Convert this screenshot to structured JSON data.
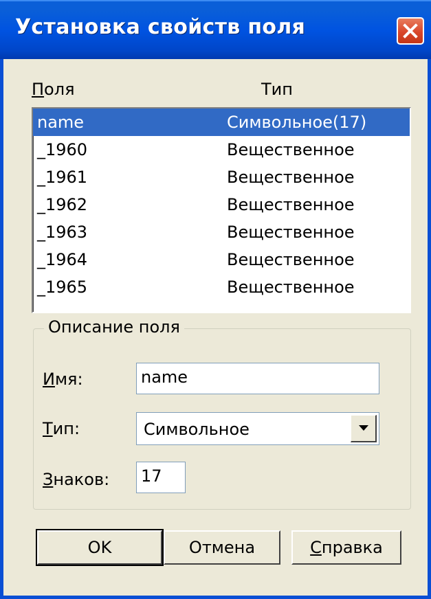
{
  "dialog": {
    "title": "Установка свойств поля",
    "close_icon": "close-icon"
  },
  "list": {
    "header_fields_prefix": "П",
    "header_fields_rest": "оля",
    "header_type": "Тип",
    "rows": [
      {
        "name": "name",
        "type": "Символьное(17)",
        "selected": true
      },
      {
        "name": "_1960",
        "type": "Вещественное",
        "selected": false
      },
      {
        "name": "_1961",
        "type": "Вещественное",
        "selected": false
      },
      {
        "name": "_1962",
        "type": "Вещественное",
        "selected": false
      },
      {
        "name": "_1963",
        "type": "Вещественное",
        "selected": false
      },
      {
        "name": "_1964",
        "type": "Вещественное",
        "selected": false
      },
      {
        "name": "_1965",
        "type": "Вещественное",
        "selected": false
      }
    ]
  },
  "description": {
    "group_title": "Описание поля",
    "name_label_prefix": "И",
    "name_label_rest": "мя:",
    "name_value": "name",
    "type_label_prefix": "Т",
    "type_label_rest": "ип:",
    "type_value": "Символьное",
    "chars_label_prefix": "З",
    "chars_label_rest": "наков:",
    "chars_value": "17"
  },
  "buttons": {
    "ok": "OK",
    "cancel": "Отмена",
    "help_prefix": "С",
    "help_rest": "правка"
  },
  "colors": {
    "titlebar": "#0053e1",
    "selection": "#316ac5",
    "close_button": "#d9462a",
    "face": "#ece9d8"
  }
}
